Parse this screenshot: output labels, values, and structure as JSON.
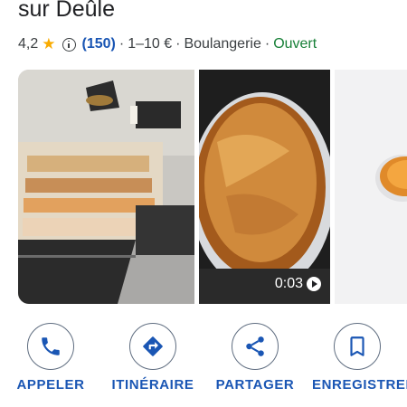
{
  "place": {
    "title_fragment": "sur Deûle",
    "rating": "4,2",
    "star": "★",
    "reviews": "(150)",
    "sep1": "·",
    "price": "1–10 €",
    "sep2": "·",
    "category": "Boulangerie",
    "sep3": "·",
    "status": "Ouvert"
  },
  "colors": {
    "accent": "#1a56b4",
    "open_status": "#188038",
    "star": "#f9ab00"
  },
  "photos": [
    {
      "name": "bakery-interior-photo"
    },
    {
      "name": "tart-video-thumbnail",
      "video_duration": "0:03"
    },
    {
      "name": "pastry-photo"
    }
  ],
  "actions": [
    {
      "label": "APPELER",
      "icon": "phone-icon"
    },
    {
      "label": "ITINÉRAIRE",
      "icon": "directions-icon"
    },
    {
      "label": "PARTAGER",
      "icon": "share-icon"
    },
    {
      "label": "ENREGISTRER",
      "icon": "bookmark-icon"
    }
  ]
}
